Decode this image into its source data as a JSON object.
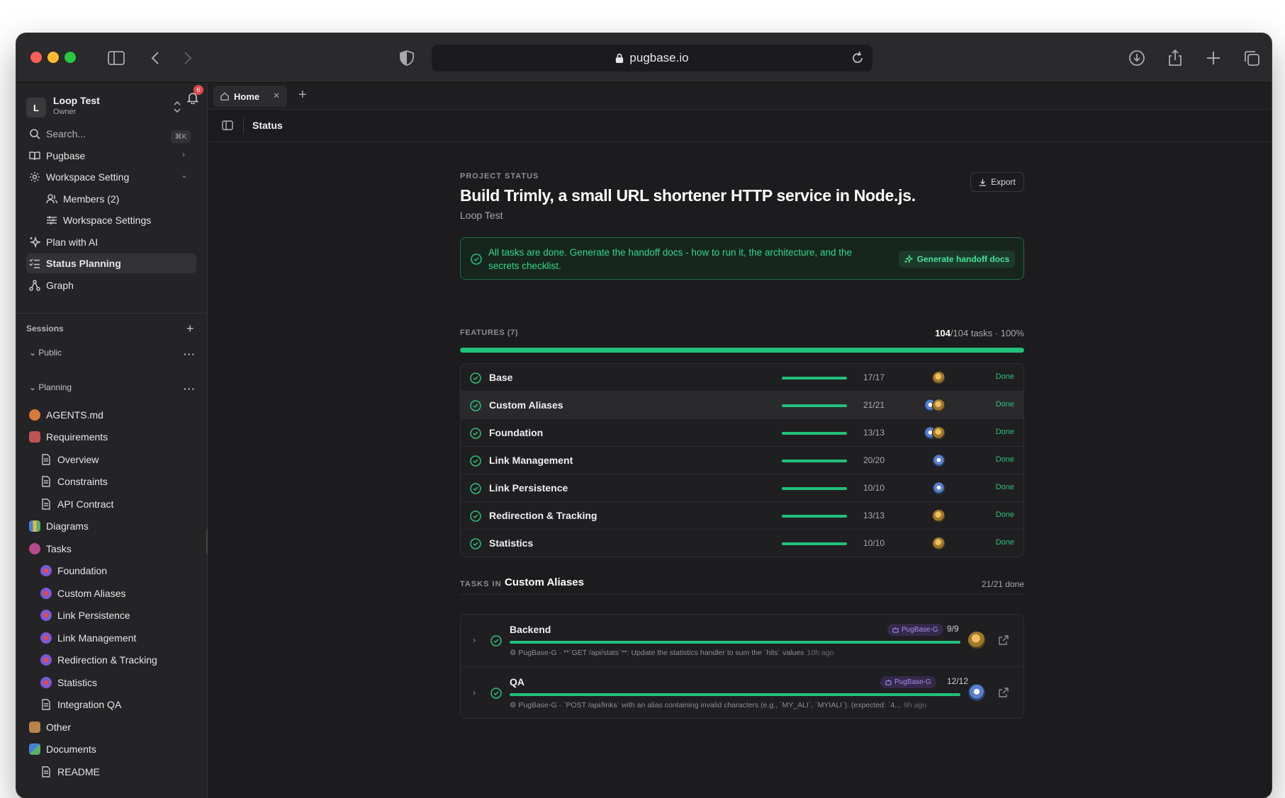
{
  "browser": {
    "url": "pugbase.io",
    "colors": {
      "close": "#ff5f57",
      "minimize": "#febc2e",
      "maximize": "#28c840"
    }
  },
  "workspace": {
    "initial": "L",
    "name": "Loop Test",
    "role": "Owner",
    "notifications": "6"
  },
  "sidebar": {
    "search_placeholder": "Search...",
    "search_shortcut": "⌘K",
    "items": [
      {
        "label": "Pugbase",
        "icon": "book-icon"
      },
      {
        "label": "Workspace Setting",
        "icon": "gear-icon"
      },
      {
        "label": "Members (2)",
        "icon": "users-icon"
      },
      {
        "label": "Workspace Settings",
        "icon": "sliders-icon"
      },
      {
        "label": "Plan with AI",
        "icon": "sparkles-icon"
      },
      {
        "label": "Status Planning",
        "icon": "checklist-icon"
      },
      {
        "label": "Graph",
        "icon": "graph-icon"
      }
    ],
    "sessions_label": "Sessions",
    "public_label": "Public",
    "planning_label": "Planning",
    "tree": [
      {
        "label": "AGENTS.md"
      },
      {
        "label": "Requirements"
      },
      {
        "label": "Overview"
      },
      {
        "label": "Constraints"
      },
      {
        "label": "API Contract"
      },
      {
        "label": "Diagrams"
      },
      {
        "label": "Tasks"
      },
      {
        "label": "Foundation"
      },
      {
        "label": "Custom Aliases"
      },
      {
        "label": "Link Persistence"
      },
      {
        "label": "Link Management"
      },
      {
        "label": "Redirection & Tracking"
      },
      {
        "label": "Statistics"
      },
      {
        "label": "Integration QA"
      },
      {
        "label": "Other"
      },
      {
        "label": "Documents"
      },
      {
        "label": "README"
      }
    ]
  },
  "tabs": [
    {
      "label": "Home"
    }
  ],
  "page": {
    "title": "Status",
    "eyebrow": "PROJECT STATUS",
    "project_title": "Build Trimly, a small URL shortener HTTP service in Node.js.",
    "workspace": "Loop Test",
    "export_label": "Export",
    "banner_message": "All tasks are done. Generate the handoff docs - how to run it, the architecture, and the secrets checklist.",
    "banner_button": "Generate handoff docs",
    "features_label": "FEATURES (7)",
    "tasks_done": "104",
    "tasks_total": "/104 tasks · 100%",
    "overall_progress": 1.0,
    "accent_color": "#22c07a"
  },
  "features": [
    {
      "name": "Base",
      "count": "17/17",
      "status": "Done",
      "progress": 1.0,
      "avatars": [
        "gold"
      ]
    },
    {
      "name": "Custom Aliases",
      "count": "21/21",
      "status": "Done",
      "progress": 1.0,
      "avatars": [
        "blue",
        "gold"
      ]
    },
    {
      "name": "Foundation",
      "count": "13/13",
      "status": "Done",
      "progress": 1.0,
      "avatars": [
        "blue",
        "gold"
      ]
    },
    {
      "name": "Link Management",
      "count": "20/20",
      "status": "Done",
      "progress": 1.0,
      "avatars": [
        "blue"
      ]
    },
    {
      "name": "Link Persistence",
      "count": "10/10",
      "status": "Done",
      "progress": 1.0,
      "avatars": [
        "blue"
      ]
    },
    {
      "name": "Redirection & Tracking",
      "count": "13/13",
      "status": "Done",
      "progress": 1.0,
      "avatars": [
        "gold"
      ]
    },
    {
      "name": "Statistics",
      "count": "10/10",
      "status": "Done",
      "progress": 1.0,
      "avatars": [
        "gold"
      ]
    }
  ],
  "tasks_section": {
    "label": "TASKS IN",
    "feature": "Custom Aliases",
    "done": "21/21 done"
  },
  "task_groups": [
    {
      "name": "Backend",
      "agent": "PugBase-G",
      "count": "9/9",
      "progress": 1.0,
      "log": "PugBase-G · **`GET /api/stats`**: Update the statistics handler to sum the `hits` values",
      "ago": "10h ago"
    },
    {
      "name": "QA",
      "agent": "PugBase-G",
      "count": "12/12",
      "progress": 1.0,
      "log": "PugBase-G · `POST /api/links` with an alias containing invalid characters (e.g., `MY_ALI`, `MYIALI`). (expected: `4...",
      "ago": "9h ago"
    }
  ]
}
